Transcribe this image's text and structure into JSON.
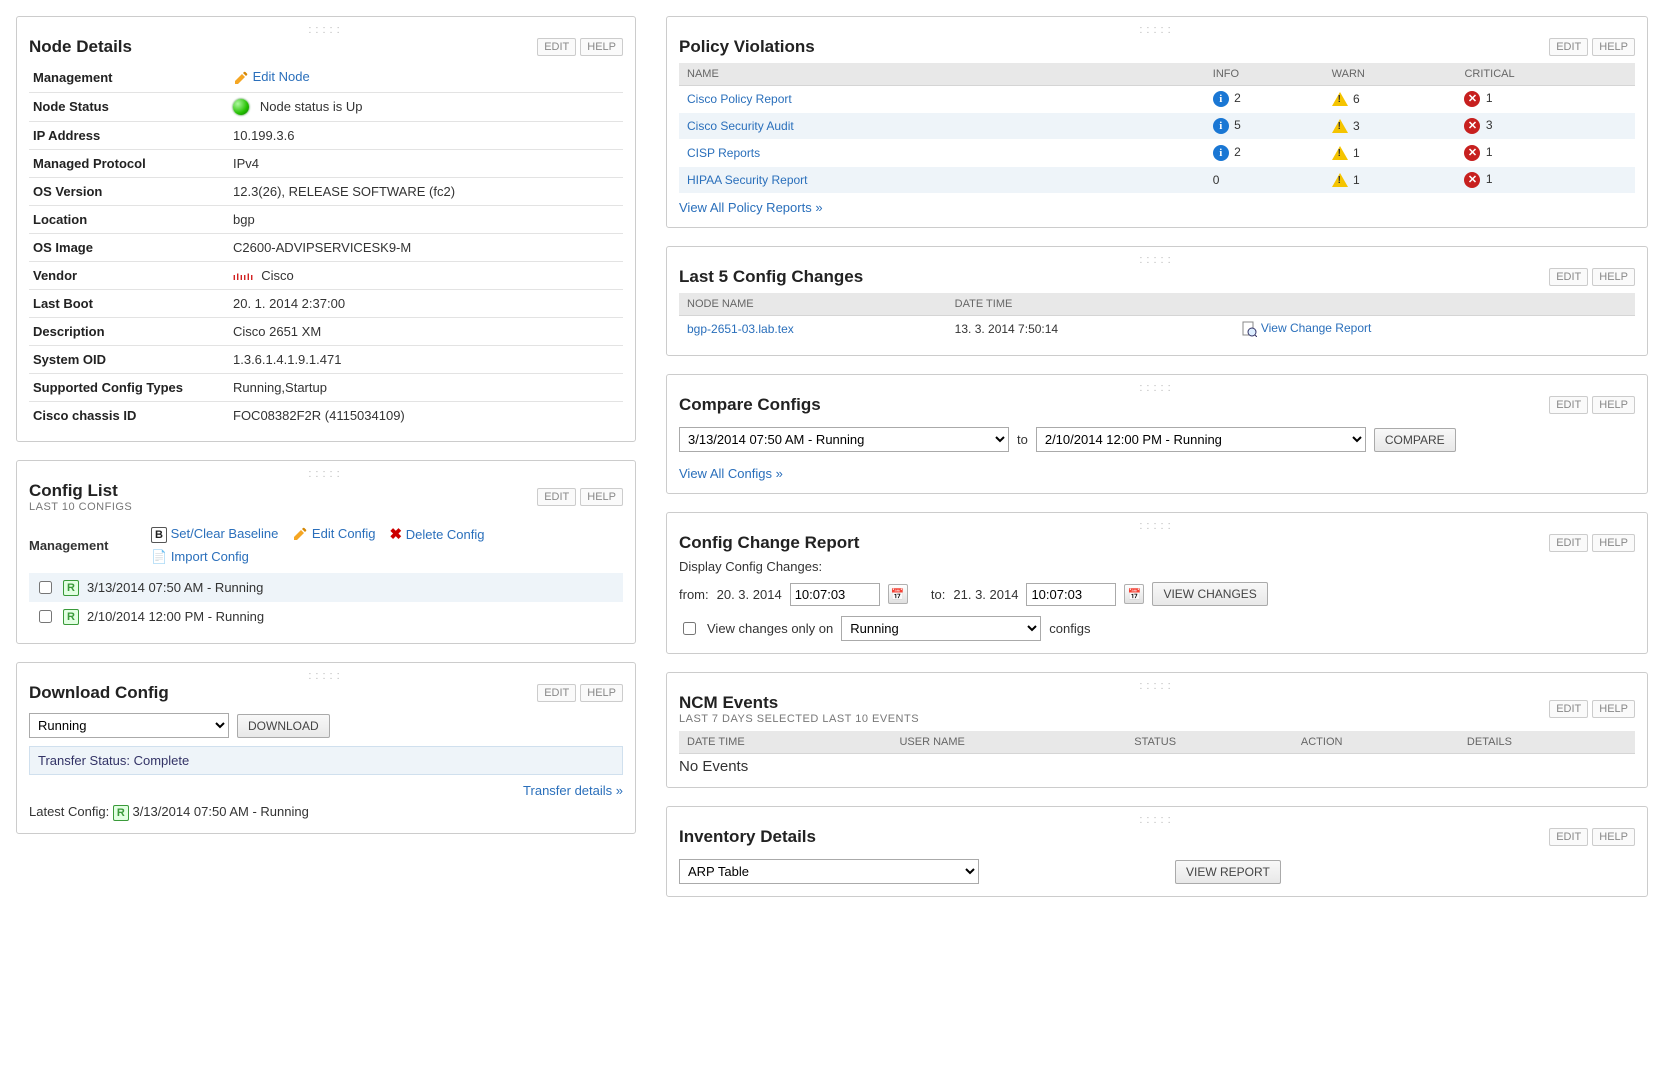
{
  "btn": {
    "edit": "EDIT",
    "help": "HELP",
    "download": "DOWNLOAD",
    "compare": "COMPARE",
    "viewChanges": "VIEW CHANGES",
    "viewReport": "VIEW REPORT"
  },
  "nodeDetails": {
    "title": "Node Details",
    "rows": {
      "managementLabel": "Management",
      "managementAction": "Edit Node",
      "statusLabel": "Node Status",
      "statusText": "Node status is Up",
      "ipLabel": "IP Address",
      "ip": "10.199.3.6",
      "protoLabel": "Managed Protocol",
      "proto": "IPv4",
      "osvLabel": "OS Version",
      "osv": "12.3(26), RELEASE SOFTWARE (fc2)",
      "locLabel": "Location",
      "loc": "bgp",
      "osiLabel": "OS Image",
      "osi": "C2600-ADVIPSERVICESK9-M",
      "vendorLabel": "Vendor",
      "vendor": "Cisco",
      "bootLabel": "Last Boot",
      "boot": "20. 1. 2014 2:37:00",
      "descLabel": "Description",
      "desc": "Cisco 2651 XM",
      "oidLabel": "System OID",
      "oid": "1.3.6.1.4.1.9.1.471",
      "supLabel": "Supported Config Types",
      "sup": "Running,Startup",
      "chassisLabel": "Cisco chassis ID",
      "chassis": "FOC08382F2R (4115034109)"
    }
  },
  "configList": {
    "title": "Config List",
    "subtitle": "LAST 10 CONFIGS",
    "mgmtLabel": "Management",
    "act": {
      "baseline": "Set/Clear Baseline",
      "edit": "Edit Config",
      "delete": "Delete Config",
      "import": "Import Config"
    },
    "items": [
      {
        "label": "3/13/2014 07:50 AM - Running"
      },
      {
        "label": "2/10/2014 12:00 PM - Running"
      }
    ]
  },
  "download": {
    "title": "Download Config",
    "selected": "Running",
    "status": "Transfer Status: Complete",
    "detailsLink": "Transfer details »",
    "latestLabel": "Latest Config:",
    "latestValue": "3/13/2014 07:50 AM - Running"
  },
  "policy": {
    "title": "Policy Violations",
    "cols": {
      "name": "NAME",
      "info": "INFO",
      "warn": "WARN",
      "crit": "CRITICAL"
    },
    "rows": [
      {
        "name": "Cisco Policy Report",
        "info": "2",
        "warn": "6",
        "crit": "1"
      },
      {
        "name": "Cisco Security Audit",
        "info": "5",
        "warn": "3",
        "crit": "3"
      },
      {
        "name": "CISP Reports",
        "info": "2",
        "warn": "1",
        "crit": "1"
      },
      {
        "name": "HIPAA Security Report",
        "info": "0",
        "warn": "1",
        "crit": "1"
      }
    ],
    "viewAll": "View All Policy Reports »"
  },
  "last5": {
    "title": "Last 5 Config Changes",
    "cols": {
      "node": "NODE NAME",
      "dt": "DATE TIME"
    },
    "row": {
      "node": "bgp-2651-03.lab.tex",
      "dt": "13. 3. 2014 7:50:14",
      "action": "View Change Report"
    }
  },
  "compare": {
    "title": "Compare Configs",
    "opt1": "3/13/2014 07:50 AM - Running",
    "to": "to",
    "opt2": "2/10/2014 12:00 PM - Running",
    "viewAll": "View All Configs »"
  },
  "ccr": {
    "title": "Config Change Report",
    "display": "Display Config Changes:",
    "fromLabel": "from:",
    "fromDate": "20. 3. 2014",
    "fromTime": "10:07:03",
    "toLabel": "to:",
    "toDate": "21. 3. 2014",
    "toTime": "10:07:03",
    "onlyLabel": "View changes only on",
    "onlySel": "Running",
    "onlySuffix": "configs"
  },
  "ncm": {
    "title": "NCM Events",
    "subtitle": "LAST 7 DAYS SELECTED LAST 10 EVENTS",
    "cols": {
      "dt": "DATE TIME",
      "user": "USER NAME",
      "status": "STATUS",
      "action": "ACTION",
      "details": "DETAILS"
    },
    "empty": "No Events"
  },
  "inv": {
    "title": "Inventory Details",
    "selected": "ARP Table"
  }
}
